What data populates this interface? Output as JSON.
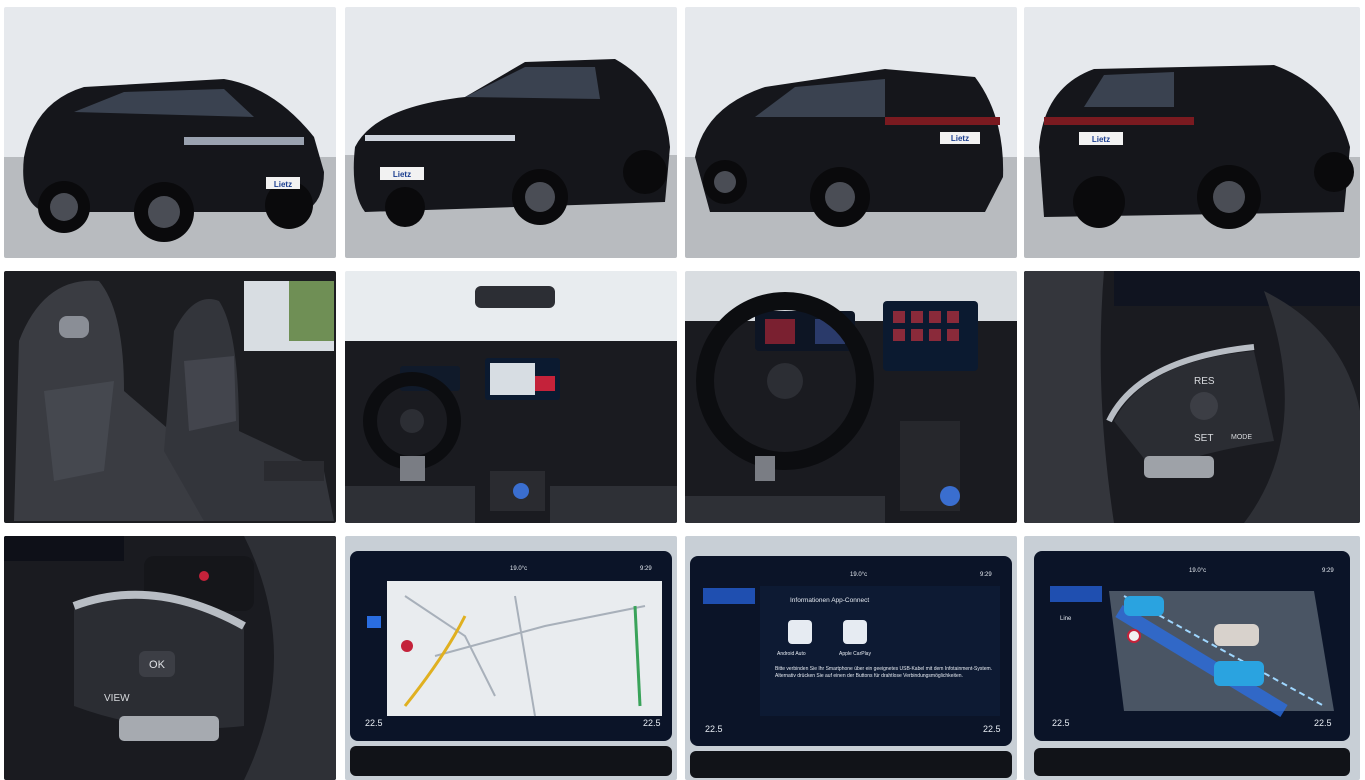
{
  "gallery": {
    "photos": [
      {
        "id": "front-left-exterior",
        "plate": "Lietz"
      },
      {
        "id": "front-right-exterior",
        "plate": "Lietz"
      },
      {
        "id": "rear-left-exterior",
        "plate": "Lietz"
      },
      {
        "id": "rear-right-exterior",
        "plate": "Lietz"
      },
      {
        "id": "front-seats"
      },
      {
        "id": "dashboard-wide"
      },
      {
        "id": "cockpit-steering-wheel"
      },
      {
        "id": "steering-wheel-right-controls",
        "buttons": [
          "RES",
          "SET",
          "MODE"
        ]
      },
      {
        "id": "steering-wheel-left-controls",
        "buttons": [
          "OK",
          "VIEW"
        ]
      },
      {
        "id": "infotainment-navigation-map",
        "temp_left": "22.5",
        "temp_right": "22.5",
        "outside_temp": "19.0°c",
        "clock": "9:29"
      },
      {
        "id": "infotainment-app-connect",
        "temp_left": "22.5",
        "temp_right": "22.5",
        "outside_temp": "19.0°c",
        "clock": "9:29",
        "panel_title": "Informationen App-Connect",
        "option_1": "Android Auto",
        "option_2": "Apple CarPlay",
        "body": "Bitte verbinden Sie Ihr Smartphone über ein geeignetes USB-Kabel mit dem Infotainment-System. Alternativ drücken Sie auf einen der Buttons für drahtlose Verbindungsmöglichkeiten."
      },
      {
        "id": "infotainment-assist-view",
        "temp_left": "22.5",
        "temp_right": "22.5",
        "outside_temp": "19.0°c",
        "clock": "9:29",
        "side_label": "Line"
      }
    ]
  },
  "colors": {
    "car_body": "#14151a",
    "wall": "#e8ebef",
    "floor": "#b9bcc0",
    "screen_bg": "#0b1a30",
    "accent_blue": "#2a6de0"
  }
}
